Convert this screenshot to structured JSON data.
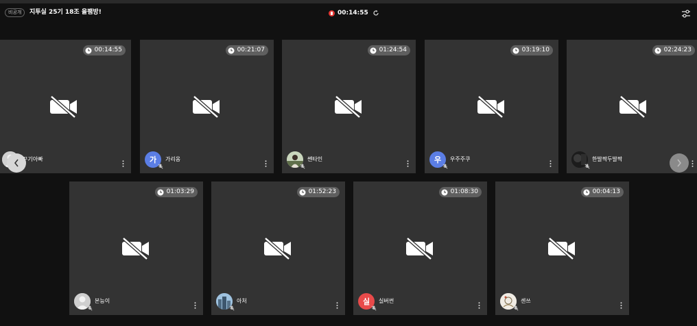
{
  "header": {
    "visibility_badge": "비공개",
    "room_title": "지투실 25기 18조 올팸방!",
    "recording_time": "00:14:55"
  },
  "colors": {
    "background": "#111111",
    "tile": "#333333",
    "timer_pill": "#5f5f5f",
    "record_red": "#e53935"
  },
  "participants": [
    {
      "name": "꾸기아빠",
      "timer": "00:14:55",
      "avatar": "photo-gray",
      "avatar_color": "#d0d0d0"
    },
    {
      "name": "가리옹",
      "timer": "00:21:07",
      "avatar": "가",
      "avatar_color": "#5b7ee5"
    },
    {
      "name": "쎈타인",
      "timer": "01:24:54",
      "avatar": "photo-person",
      "avatar_color": "#7a8a6a"
    },
    {
      "name": "우주주쿠",
      "timer": "03:19:10",
      "avatar": "우",
      "avatar_color": "#5b7ee5"
    },
    {
      "name": "한발짝두발짝",
      "timer": "02:24:23",
      "avatar": "photo-dark",
      "avatar_color": "#2a2a2a"
    },
    {
      "name": "본능이",
      "timer": "01:03:29",
      "avatar": "photo-silhouette",
      "avatar_color": "#cfcfcf"
    },
    {
      "name": "아처",
      "timer": "01:52:23",
      "avatar": "photo-city",
      "avatar_color": "#6a8aa5"
    },
    {
      "name": "실버썬",
      "timer": "01:08:30",
      "avatar": "실",
      "avatar_color": "#e84a4a"
    },
    {
      "name": "센쓰",
      "timer": "00:04:13",
      "avatar": "photo-sketch",
      "avatar_color": "#e8e4dc"
    }
  ]
}
